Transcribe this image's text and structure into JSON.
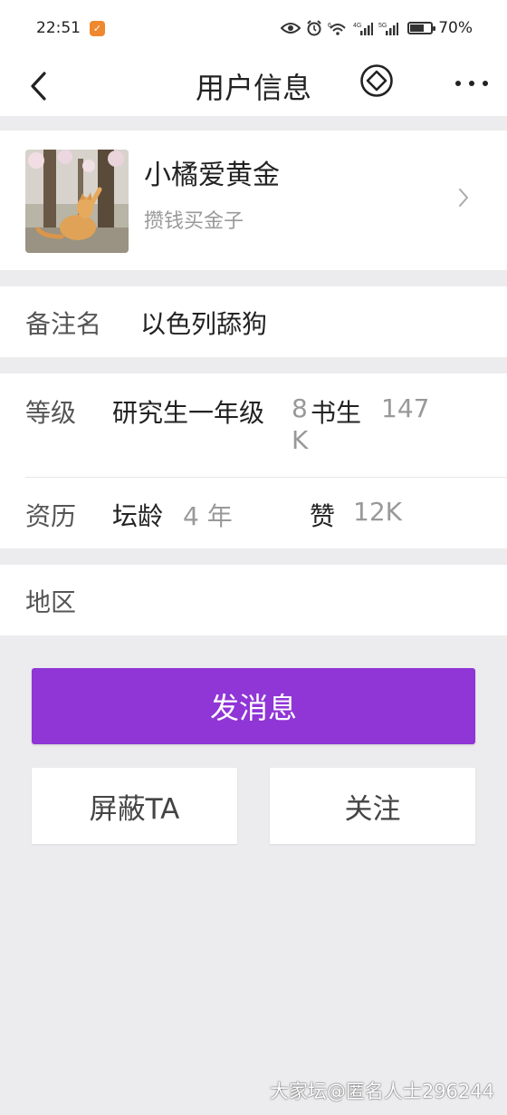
{
  "status_bar": {
    "time": "22:51",
    "battery_text": "70%",
    "battery_level": 0.7,
    "net_labels": [
      "6",
      "4G",
      "5G"
    ]
  },
  "nav": {
    "title": "用户信息"
  },
  "profile": {
    "username": "小橘爱黄金",
    "signature": "攒钱买金子"
  },
  "remark": {
    "label": "备注名",
    "value": "以色列舔狗"
  },
  "level": {
    "label": "等级",
    "value": "研究生一年级",
    "rank_num": "8",
    "rank_tail": "K",
    "rank_name": "书生",
    "count": "147"
  },
  "experience": {
    "label": "资历",
    "forum_age_key": "坛龄",
    "forum_age_value": "4 年",
    "likes_key": "赞",
    "likes_value": "12K"
  },
  "region": {
    "label": "地区"
  },
  "actions": {
    "message": "发消息",
    "block": "屏蔽TA",
    "follow": "关注"
  },
  "watermark": "大家坛@匿名人士296244",
  "colors": {
    "accent": "#9035d6",
    "background": "#ececee"
  }
}
